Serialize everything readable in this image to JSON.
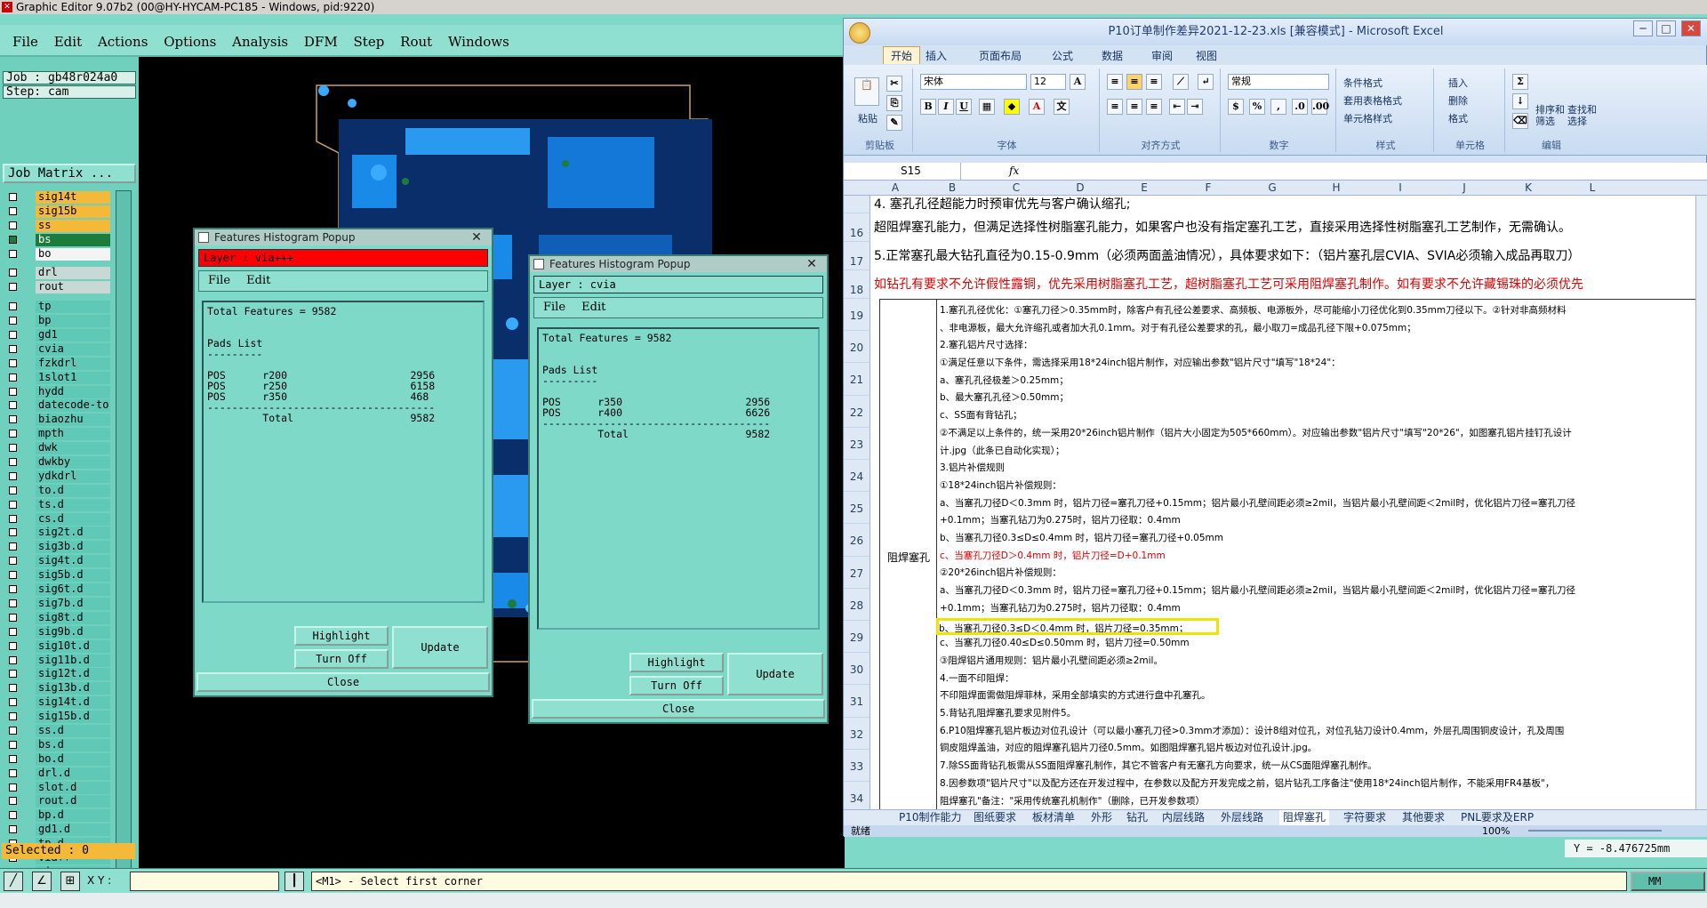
{
  "ge": {
    "title": "Graphic Editor 9.07b2 (00@HY-HYCAM-PC185 - Windows, pid:9220)",
    "menu": [
      "File",
      "Edit",
      "Actions",
      "Options",
      "Analysis",
      "DFM",
      "Step",
      "Rout",
      "Windows"
    ],
    "job": "Job : gb48r024a0",
    "step": "Step: cam",
    "job_matrix": "Job Matrix ...",
    "layers": [
      {
        "name": "sig14t",
        "style": "orange",
        "check": "off"
      },
      {
        "name": "sig15b",
        "style": "orange",
        "check": "off"
      },
      {
        "name": "ss",
        "style": "orange",
        "check": "off"
      },
      {
        "name": "bs",
        "style": "board",
        "check": "on"
      },
      {
        "name": "bo",
        "style": "white",
        "check": "off"
      },
      {
        "gap": true
      },
      {
        "name": "drl",
        "style": "grey",
        "check": "off"
      },
      {
        "name": "rout",
        "style": "grey",
        "check": "off"
      },
      {
        "gap": true
      },
      {
        "name": "tp",
        "style": "",
        "check": "off"
      },
      {
        "name": "bp",
        "style": "",
        "check": "off"
      },
      {
        "name": "gd1",
        "style": "",
        "check": "off"
      },
      {
        "name": "cvia",
        "style": "",
        "check": "off"
      },
      {
        "name": "fzkdrl",
        "style": "",
        "check": "off"
      },
      {
        "name": "1slot1",
        "style": "",
        "check": "off"
      },
      {
        "name": "hydd",
        "style": "",
        "check": "off"
      },
      {
        "name": "datecode-to",
        "style": "",
        "check": "off"
      },
      {
        "name": "biaozhu",
        "style": "",
        "check": "off"
      },
      {
        "name": "mpth",
        "style": "",
        "check": "off"
      },
      {
        "name": "dwk",
        "style": "",
        "check": "off"
      },
      {
        "name": "dwkby",
        "style": "",
        "check": "off"
      },
      {
        "name": "ydkdrl",
        "style": "",
        "check": "off"
      },
      {
        "name": "to.d",
        "style": "",
        "check": "off"
      },
      {
        "name": "ts.d",
        "style": "",
        "check": "off"
      },
      {
        "name": "cs.d",
        "style": "",
        "check": "off"
      },
      {
        "name": "sig2t.d",
        "style": "",
        "check": "off"
      },
      {
        "name": "sig3b.d",
        "style": "",
        "check": "off"
      },
      {
        "name": "sig4t.d",
        "style": "",
        "check": "off"
      },
      {
        "name": "sig5b.d",
        "style": "",
        "check": "off"
      },
      {
        "name": "sig6t.d",
        "style": "",
        "check": "off"
      },
      {
        "name": "sig7b.d",
        "style": "",
        "check": "off"
      },
      {
        "name": "sig8t.d",
        "style": "",
        "check": "off"
      },
      {
        "name": "sig9b.d",
        "style": "",
        "check": "off"
      },
      {
        "name": "sig10t.d",
        "style": "",
        "check": "off"
      },
      {
        "name": "sig11b.d",
        "style": "",
        "check": "off"
      },
      {
        "name": "sig12t.d",
        "style": "",
        "check": "off"
      },
      {
        "name": "sig13b.d",
        "style": "",
        "check": "off"
      },
      {
        "name": "sig14t.d",
        "style": "",
        "check": "off"
      },
      {
        "name": "sig15b.d",
        "style": "",
        "check": "off"
      },
      {
        "name": "ss.d",
        "style": "",
        "check": "off"
      },
      {
        "name": "bs.d",
        "style": "",
        "check": "off"
      },
      {
        "name": "bo.d",
        "style": "",
        "check": "off"
      },
      {
        "name": "drl.d",
        "style": "",
        "check": "off"
      },
      {
        "name": "slot.d",
        "style": "",
        "check": "off"
      },
      {
        "name": "rout.d",
        "style": "",
        "check": "off"
      },
      {
        "name": "bp.d",
        "style": "",
        "check": "off"
      },
      {
        "name": "gd1.d",
        "style": "",
        "check": "off"
      },
      {
        "name": "tp.d",
        "style": "",
        "check": "off"
      },
      {
        "name": "via++",
        "style": "",
        "check": "off"
      },
      {
        "name": "via+++",
        "style": "",
        "check": "red"
      }
    ],
    "selected": "Selected : 0",
    "xy_label": "X Y :",
    "prompt": "<M1> - Select first corner",
    "units": "MM",
    "coord": "Y = -8.476725mm"
  },
  "popup1": {
    "title": "Features Histogram Popup",
    "layer": "Layer :  via+++",
    "menu_file": "File",
    "menu_edit": "Edit",
    "body": "Total Features = 9582\n\n\nPads List\n---------\n\nPOS      r200                    2956\nPOS      r250                    6158\nPOS      r350                    468\n-------------------------------------\n         Total                   9582",
    "highlight": "Highlight",
    "turnoff": "Turn Off",
    "update": "Update",
    "close": "Close"
  },
  "popup2": {
    "title": "Features Histogram Popup",
    "layer": "Layer :  cvia",
    "menu_file": "File",
    "menu_edit": "Edit",
    "body": "Total Features = 9582\n\n\nPads List\n---------\n\nPOS      r350                    2956\nPOS      r400                    6626\n-------------------------------------\n         Total                   9582",
    "highlight": "Highlight",
    "turnoff": "Turn Off",
    "update": "Update",
    "close": "Close"
  },
  "excel": {
    "title": "P10订单制作差异2021-12-23.xls  [兼容模式] - Microsoft Excel",
    "tabs": [
      "开始",
      "插入",
      "页面布局",
      "公式",
      "数据",
      "审阅",
      "视图"
    ],
    "font_name": "宋体",
    "font_size": "12",
    "number_format": "常规",
    "groups": [
      "剪贴板",
      "字体",
      "对齐方式",
      "数字",
      "样式",
      "单元格",
      "编辑"
    ],
    "paste": "粘贴",
    "cond_format": "条件格式",
    "table_format": "套用表格格式",
    "cell_style": "单元格样式",
    "insert": "插入",
    "delete": "删除",
    "format": "格式",
    "sort": "排序和\n筛选",
    "find": "查找和\n选择",
    "cell_ref": "S15",
    "fx": "fx",
    "columns": [
      "A",
      "B",
      "C",
      "D",
      "E",
      "F",
      "G",
      "H",
      "I",
      "J",
      "K",
      "L"
    ],
    "rows": [
      {
        "num": "",
        "text": "4. 塞孔孔径超能力时预审优先与客户确认缩孔;",
        "color": "#000"
      },
      {
        "num": "16",
        "text": "超阻焊塞孔能力，但满足选择性树脂塞孔能力，如果客户也没有指定塞孔工艺，直接采用选择性树脂塞孔工艺制作，无需确认。",
        "color": "#000"
      },
      {
        "num": "17",
        "text": "5.正常塞孔最大钻孔直径为0.15-0.9mm（必须两面盖油情况），具体要求如下：（铝片塞孔层CVIA、SVIA必须输入成品再取刀）",
        "color": "#000"
      },
      {
        "num": "18",
        "text": "如钻孔有要求不允许假性露铜，优先采用树脂塞孔工艺，超树脂塞孔工艺可采用阻焊塞孔制作。如有要求不允许藏锡珠的必须优先",
        "color": "#d00"
      }
    ],
    "section_label": "阻焊塞孔",
    "detail_lines": [
      {
        "text": "1.塞孔孔径优化：①塞孔刀径＞0.35mm时，除客户有孔径公差要求、高频板、电源板外，尽可能缩小刀径优化到0.35mm刀径以下。②针对非高频材料",
        "color": "#000"
      },
      {
        "text": "、非电源板，最大允许缩孔或者加大孔0.1mm。对于有孔径公差要求的孔，最小取刀=成品孔径下限+0.075mm；",
        "color": "#000"
      },
      {
        "text": "2.塞孔铝片尺寸选择：",
        "color": "#000"
      },
      {
        "text": "①满足任意以下条件，需选择采用18*24inch铝片制作，对应输出参数\"铝片尺寸\"填写\"18*24\"：",
        "color": "#000"
      },
      {
        "text": "a、塞孔孔径极差＞0.25mm；",
        "color": "#000"
      },
      {
        "text": "b、最大塞孔孔径＞0.50mm；",
        "color": "#000"
      },
      {
        "text": "c、SS面有背钻孔；",
        "color": "#000"
      },
      {
        "text": "②不满足以上条件的，统一采用20*26inch铝片制作（铝片大小固定为505*660mm）。对应输出参数\"铝片尺寸\"填写\"20*26\"，如图塞孔铝片挂钉孔设计",
        "color": "#000"
      },
      {
        "text": "计.jpg（此条已自动化实现）；",
        "color": "#000"
      },
      {
        "text": "3.铝片补偿规则",
        "color": "#000"
      },
      {
        "text": "①18*24inch铝片补偿规则：",
        "color": "#000"
      },
      {
        "text": "a、当塞孔刀径D＜0.3mm 时，铝片刀径=塞孔刀径+0.15mm；铝片最小孔壁间距必须≥2mil，当铝片最小孔壁间距＜2mil时，优化铝片刀径=塞孔刀径",
        "color": "#000"
      },
      {
        "text": "+0.1mm；当塞孔钻刀为0.275时，铝片刀径取：0.4mm",
        "color": "#000"
      },
      {
        "text": "b、当塞孔刀径0.3≤D≤0.4mm 时，铝片刀径=塞孔刀径+0.05mm",
        "color": "#000"
      },
      {
        "text": "c、当塞孔刀径D＞0.4mm 时，铝片刀径=D+0.1mm",
        "color": "#d00"
      },
      {
        "text": "②20*26inch铝片补偿规则：",
        "color": "#000"
      },
      {
        "text": "a、当塞孔刀径D＜0.3mm 时，铝片刀径=塞孔刀径+0.15mm；铝片最小孔壁间距必须≥2mil，当铝片最小孔壁间距＜2mil时，优化铝片刀径=塞孔刀径",
        "color": "#000"
      },
      {
        "text": "+0.1mm；当塞孔钻刀为0.275时，铝片刀径取：0.4mm",
        "color": "#000"
      },
      {
        "text": "b、当塞孔刀径0.3≤D＜0.4mm 时，铝片刀径=0.35mm；",
        "color": "#000"
      },
      {
        "text": "c、当塞孔刀径0.40≤D≤0.50mm 时，铝片刀径=0.50mm",
        "color": "#000"
      },
      {
        "text": "③阻焊铝片通用规则：铝片最小孔壁间距必须≥2mil。",
        "color": "#000"
      },
      {
        "text": "4.一面不印阻焊：",
        "color": "#000"
      },
      {
        "text": "不印阻焊面需做阻焊菲林，采用全部填实的方式进行盘中孔塞孔。",
        "color": "#000"
      },
      {
        "text": "5.背钻孔阻焊塞孔要求见附件5。",
        "color": "#000"
      },
      {
        "text": "6.P10阻焊塞孔铝片板边对位孔设计（可以最小塞孔刀径>0.3mm才添加）：设计8组对位孔，对位孔钻刀设计0.4mm，外层孔周围铜皮设计，孔及周围",
        "color": "#000"
      },
      {
        "text": "铜皮阻焊盖油，对应的阻焊塞孔铝片刀径0.5mm。如图阻焊塞孔铝片板边对位孔设计.jpg。",
        "color": "#000"
      },
      {
        "text": "7.除SS面背钻孔板需从SS面阻焊塞孔制作，其它不管客户有无塞孔方向要求，统一从CS面阻焊塞孔制作。",
        "color": "#000"
      },
      {
        "text": "8.因参数项\"铝片尺寸\"以及配方还在开发过程中，在参数以及配方开发完成之前，铝片钻孔工序备注\"使用18*24inch铝片制作，不能采用FR4基板\"，",
        "color": "#000"
      },
      {
        "text": "阻焊塞孔\"备注：\"采用传统塞孔机制作\"（删除，已开发参数项）",
        "color": "#000"
      }
    ],
    "detail_rownums": [
      "19",
      "20",
      "21",
      "22",
      "23",
      "24",
      "25",
      "26",
      "27",
      "28",
      "29",
      "30",
      "31",
      "32",
      "33",
      "34"
    ],
    "sheet_tabs": [
      "P10制作能力",
      "图纸要求",
      "板材清单",
      "外形",
      "钻孔",
      "内层线路",
      "外层线路",
      "阻焊塞孔",
      "字符要求",
      "其他要求",
      "PNL要求及ERP"
    ],
    "status": "就绪",
    "zoom": "100%"
  }
}
